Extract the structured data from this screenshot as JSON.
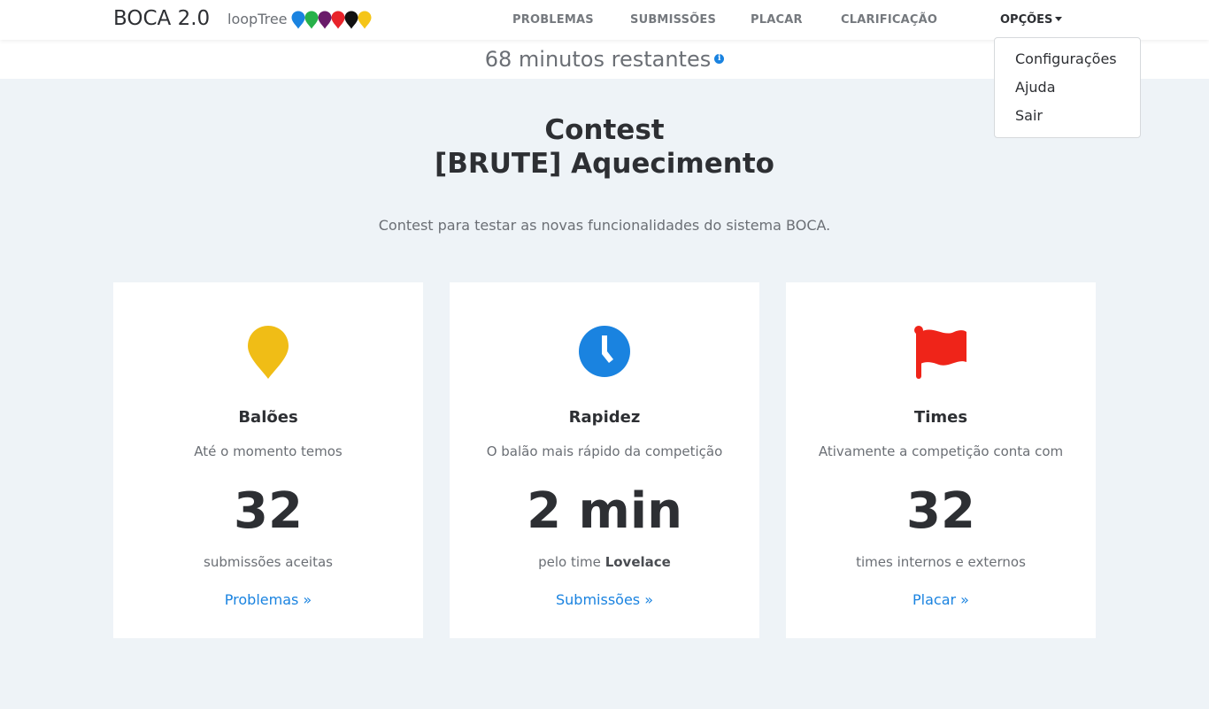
{
  "navbar": {
    "brand": "BOCA 2.0",
    "subbrand": "loopTree",
    "balloon_colors": [
      "#1a83e0",
      "#27b14a",
      "#6a1b6a",
      "#e8232a",
      "#111111",
      "#f5c518"
    ],
    "links": {
      "problemas": "PROBLEMAS",
      "submissoes": "SUBMISSÕES",
      "placar": "PLACAR",
      "clarificacao": "CLARIFICAÇÃO"
    },
    "options": "OPÇÕES"
  },
  "dropdown": {
    "items": [
      "Configurações",
      "Ajuda",
      "Sair"
    ]
  },
  "countdown": {
    "text": "68 minutos restantes",
    "info_icon": "info-icon"
  },
  "hero": {
    "title_line1": "Contest",
    "title_line2": "[BRUTE] Aquecimento",
    "description": "Contest para testar as novas funcionalidades do sistema BOCA."
  },
  "cards": [
    {
      "icon": "balloon-icon",
      "icon_color": "#f0bd16",
      "title": "Balões",
      "subtitle": "Até o momento temos",
      "value": "32",
      "footer": "submissões aceitas",
      "link": "Problemas »"
    },
    {
      "icon": "clock-icon",
      "icon_color": "#1a83e0",
      "title": "Rapidez",
      "subtitle": "O balão mais rápido da competição",
      "value": "2 min",
      "footer_prefix": "pelo time",
      "footer_team": "Lovelace",
      "link": "Submissões »"
    },
    {
      "icon": "flag-icon",
      "icon_color": "#ef2419",
      "title": "Times",
      "subtitle": "Ativamente a competição conta com",
      "value": "32",
      "footer": "times internos e externos",
      "link": "Placar »"
    }
  ]
}
